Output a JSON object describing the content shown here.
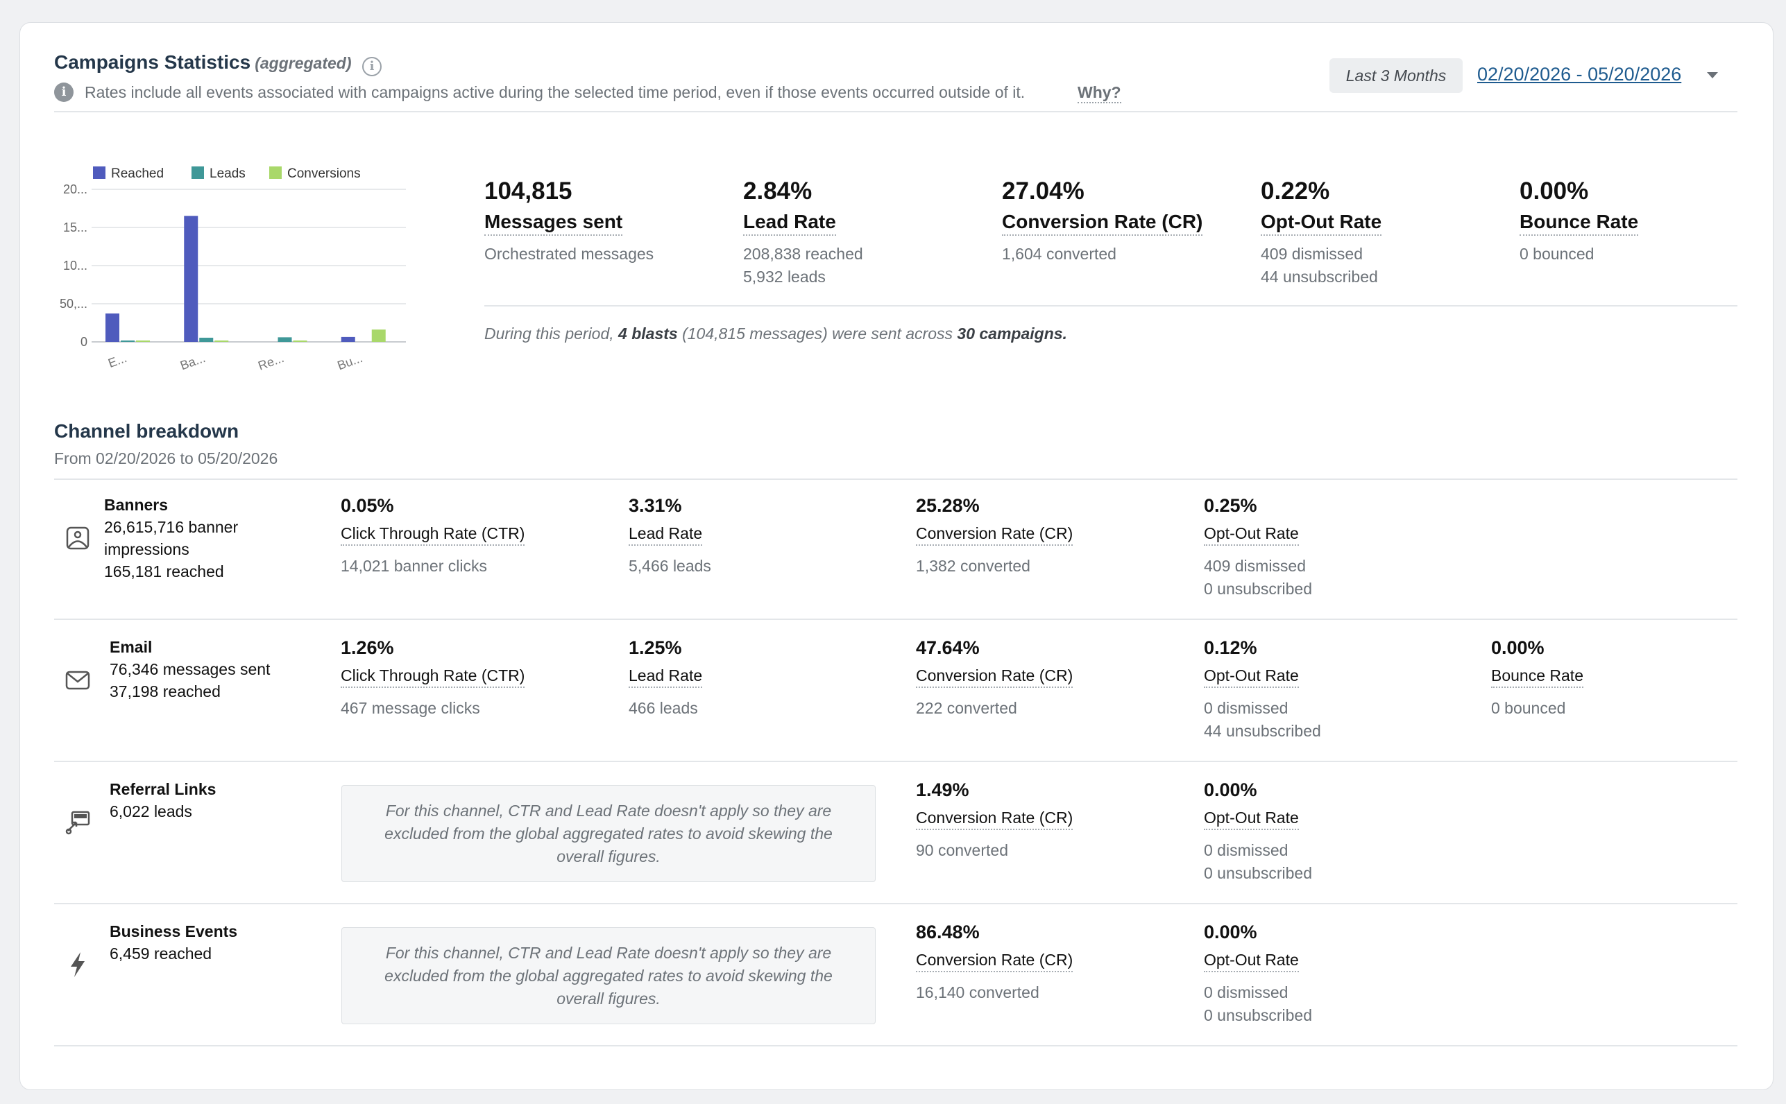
{
  "header": {
    "title": "Campaigns Statistics",
    "title_suffix": "(aggregated)",
    "note": "Rates include all events associated with campaigns active during the selected time period, even if those events occurred outside of it.",
    "why_link": "Why?",
    "range_button": "Last 3 Months",
    "date_range": "02/20/2026 - 05/20/2026"
  },
  "chart_data": {
    "type": "bar",
    "title": "",
    "categories": [
      "E...",
      "Ba...",
      "Re...",
      "Bu..."
    ],
    "y_tick_labels": [
      "0",
      "50,...",
      "10...",
      "15...",
      "20..."
    ],
    "ylim": [
      0,
      200000
    ],
    "grid": true,
    "legend_position": "top",
    "series": [
      {
        "name": "Reached",
        "color": "#4f5bbd",
        "values": [
          37198,
          165181,
          0,
          6459
        ]
      },
      {
        "name": "Leads",
        "color": "#3f9898",
        "values": [
          466,
          5466,
          6022,
          0
        ]
      },
      {
        "name": "Conversions",
        "color": "#a9d86a",
        "values": [
          222,
          1382,
          90,
          16140
        ]
      }
    ]
  },
  "kpis": [
    {
      "value": "104,815",
      "label": "Messages sent",
      "sub": [
        "Orchestrated messages"
      ]
    },
    {
      "value": "2.84%",
      "label": "Lead Rate",
      "sub": [
        "208,838 reached",
        "5,932 leads"
      ]
    },
    {
      "value": "27.04%",
      "label": "Conversion Rate (CR)",
      "sub": [
        "1,604 converted"
      ]
    },
    {
      "value": "0.22%",
      "label": "Opt-Out Rate",
      "sub": [
        "409 dismissed",
        "44 unsubscribed"
      ]
    },
    {
      "value": "0.00%",
      "label": "Bounce Rate",
      "sub": [
        "0 bounced"
      ]
    }
  ],
  "period_summary": {
    "prefix": "During this period,",
    "blasts": "4 blasts",
    "middle": "(104,815 messages) were sent across",
    "campaigns": "30 campaigns."
  },
  "channels_section": {
    "title": "Channel breakdown",
    "subtitle": "From 02/20/2026 to 05/20/2026"
  },
  "channels": [
    {
      "name": "Banners",
      "icon": "image-icon",
      "lines": [
        "26,615,716 banner",
        "impressions",
        "165,181 reached"
      ],
      "metrics": [
        {
          "value": "0.05%",
          "label": "Click Through Rate (CTR)",
          "sub": [
            "14,021 banner clicks"
          ]
        },
        {
          "value": "3.31%",
          "label": "Lead Rate",
          "sub": [
            "5,466 leads"
          ]
        },
        {
          "value": "25.28%",
          "label": "Conversion Rate (CR)",
          "sub": [
            "1,382 converted"
          ]
        },
        {
          "value": "0.25%",
          "label": "Opt-Out Rate",
          "sub": [
            "409 dismissed",
            "0 unsubscribed"
          ]
        }
      ]
    },
    {
      "name": "Email",
      "icon": "mail-icon",
      "lines": [
        "76,346 messages sent",
        "37,198 reached"
      ],
      "metrics": [
        {
          "value": "1.26%",
          "label": "Click Through Rate (CTR)",
          "sub": [
            "467 message clicks"
          ]
        },
        {
          "value": "1.25%",
          "label": "Lead Rate",
          "sub": [
            "466 leads"
          ]
        },
        {
          "value": "47.64%",
          "label": "Conversion Rate (CR)",
          "sub": [
            "222 converted"
          ]
        },
        {
          "value": "0.12%",
          "label": "Opt-Out Rate",
          "sub": [
            "0 dismissed",
            "44 unsubscribed"
          ]
        },
        {
          "value": "0.00%",
          "label": "Bounce Rate",
          "sub": [
            "0 bounced"
          ]
        }
      ]
    },
    {
      "name": "Referral Links",
      "icon": "referral-link-icon",
      "lines": [
        "6,022 leads"
      ],
      "notice": "For this channel, CTR and Lead Rate doesn't apply so they are excluded from the global aggregated rates to avoid skewing the overall figures.",
      "metrics": [
        {
          "value": "1.49%",
          "label": "Conversion Rate (CR)",
          "sub": [
            "90 converted"
          ]
        },
        {
          "value": "0.00%",
          "label": "Opt-Out Rate",
          "sub": [
            "0 dismissed",
            "0 unsubscribed"
          ]
        }
      ]
    },
    {
      "name": "Business Events",
      "icon": "lightning-icon",
      "lines": [
        "6,459 reached"
      ],
      "notice": "For this channel, CTR and Lead Rate doesn't apply so they are excluded from the global aggregated rates to avoid skewing the overall figures.",
      "metrics": [
        {
          "value": "86.48%",
          "label": "Conversion Rate (CR)",
          "sub": [
            "16,140 converted"
          ]
        },
        {
          "value": "0.00%",
          "label": "Opt-Out Rate",
          "sub": [
            "0 dismissed",
            "0 unsubscribed"
          ]
        }
      ]
    }
  ]
}
